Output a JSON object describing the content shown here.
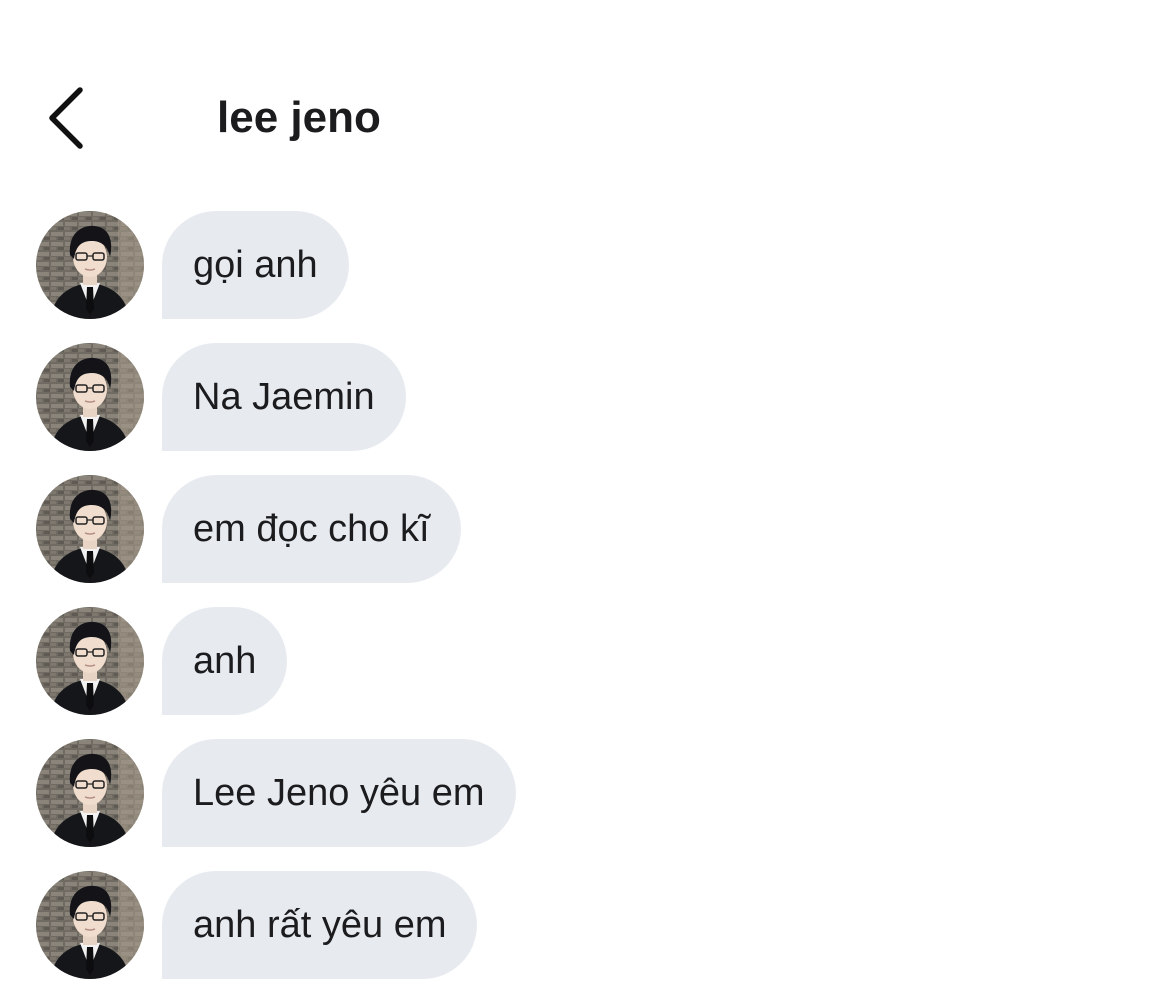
{
  "header": {
    "title": "lee jeno",
    "back_icon": "chevron-left-icon"
  },
  "messages": [
    {
      "text": "gọi anh"
    },
    {
      "text": "Na Jaemin"
    },
    {
      "text": "em đọc cho kĩ"
    },
    {
      "text": "anh"
    },
    {
      "text": "Lee Jeno yêu em"
    },
    {
      "text": "anh rất yêu em"
    }
  ],
  "colors": {
    "bubble": "#e7ebf0",
    "text": "#1c1c1e",
    "background": "#ffffff"
  }
}
